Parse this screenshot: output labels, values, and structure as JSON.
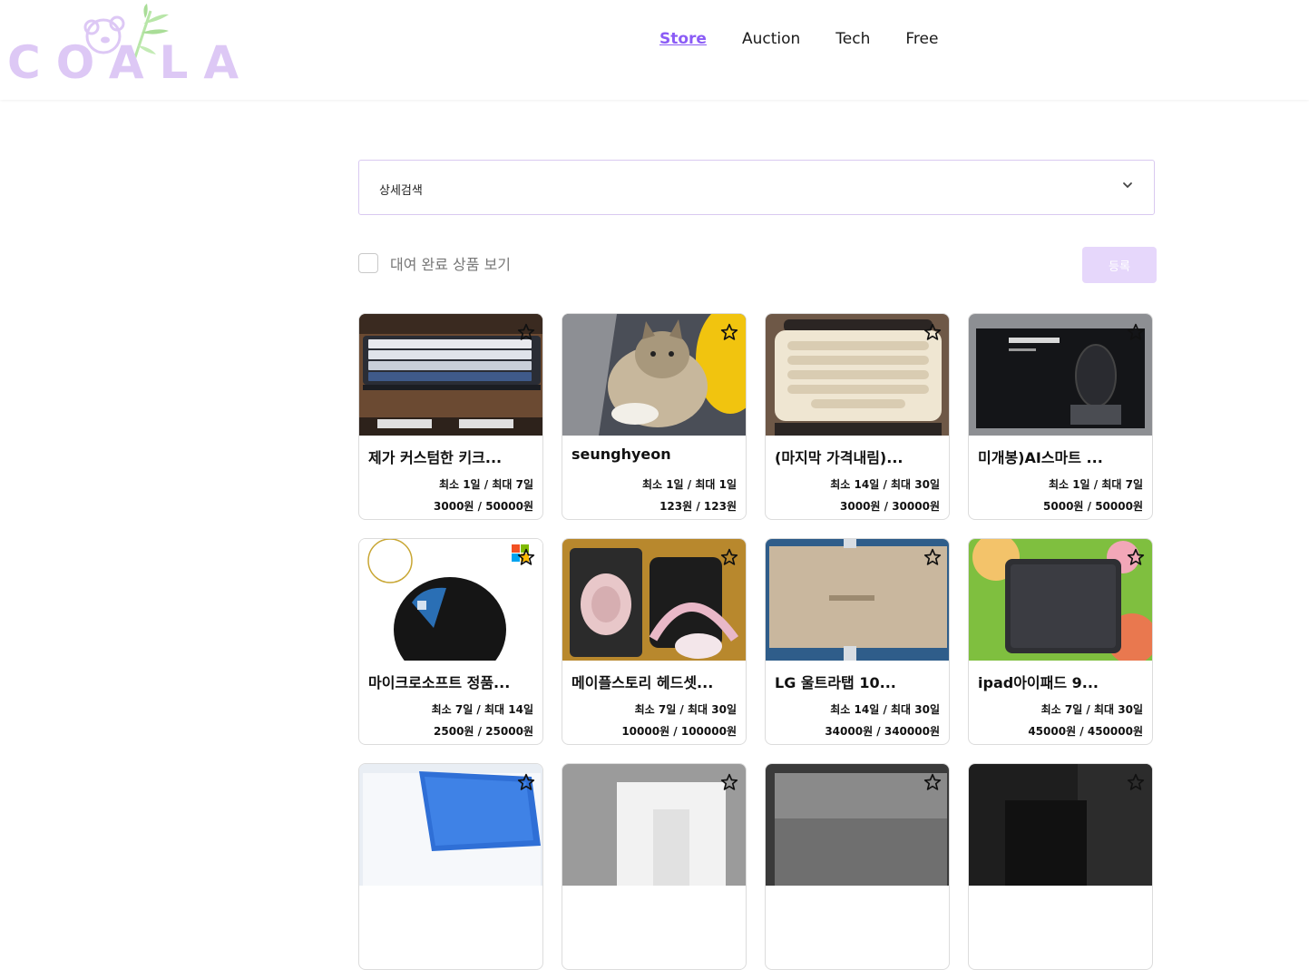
{
  "brand": {
    "logo_text": "COALA",
    "accent_color": "#8b5cf6",
    "logo_color": "#ddc8f5"
  },
  "nav": {
    "items": [
      {
        "label": "Store",
        "active": true
      },
      {
        "label": "Auction",
        "active": false
      },
      {
        "label": "Tech",
        "active": false
      },
      {
        "label": "Free",
        "active": false
      }
    ]
  },
  "search": {
    "label": "상세검색",
    "icon": "chevron-down-icon"
  },
  "filter": {
    "show_completed_label": "대여 완료 상품 보기",
    "checked": false
  },
  "register_button": {
    "label": "등록"
  },
  "products": [
    {
      "title": "제가 커스텀한 키크...",
      "period": "최소 1일 / 최대 7일",
      "price": "3000원 / 50000원",
      "image": "keyboard-photo"
    },
    {
      "title": "seunghyeon",
      "period": "최소 1일 / 최대 1일",
      "price": "123원 / 123원",
      "image": "cat-photo"
    },
    {
      "title": "(마지막 가격내림)...",
      "period": "최소 14일 / 최대 30일",
      "price": "3000원 / 30000원",
      "image": "retro-keyboard-photo"
    },
    {
      "title": "미개봉)AI스마트 ...",
      "period": "최소 1일 / 최대 7일",
      "price": "5000원 / 50000원",
      "image": "iflytek-mouse-box-photo"
    },
    {
      "title": "마이크로소프트 정품...",
      "period": "최소 7일 / 최대 14일",
      "price": "2500원 / 25000원",
      "image": "microsoft-mouse-photo"
    },
    {
      "title": "메이플스토리 헤드셋...",
      "period": "최소 7일 / 최대 30일",
      "price": "10000원 / 100000원",
      "image": "headset-photo"
    },
    {
      "title": "LG 울트라탭 10...",
      "period": "최소 14일 / 최대 30일",
      "price": "34000원 / 340000원",
      "image": "lg-box-photo"
    },
    {
      "title": "ipad아이패드 9...",
      "period": "최소 7일 / 최대 30일",
      "price": "45000원 / 450000원",
      "image": "ipad-photo"
    },
    {
      "title": "",
      "period": "",
      "price": "",
      "image": "tablet-case-photo"
    },
    {
      "title": "",
      "period": "",
      "price": "",
      "image": "boxed-device-photo"
    },
    {
      "title": "",
      "period": "",
      "price": "",
      "image": "wrapped-item-photo"
    },
    {
      "title": "",
      "period": "",
      "price": "",
      "image": "dark-item-photo"
    }
  ]
}
